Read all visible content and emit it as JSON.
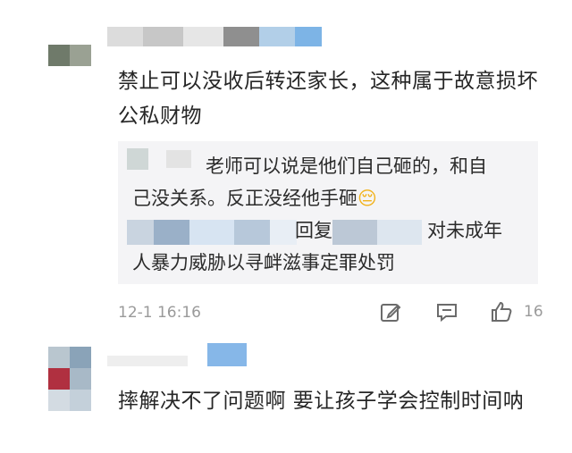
{
  "comment1": {
    "text": "禁止可以没收后转还家长，这种属于故意损坏公私财物",
    "reply": {
      "line1": "老师可以说是他们自己砸的，和自",
      "line2": "己没关系。反正没经他手砸",
      "line3_mid": "回复",
      "line3_end": "对未成年",
      "line4": "人暴力威胁以寻衅滋事定罪处罚"
    },
    "timestamp": "12-1 16:16",
    "like_count": "16"
  },
  "comment2": {
    "text": "摔解决不了问题啊 要让孩子学会控制时间呐"
  },
  "colors": {
    "reply_bg": "#f4f4f6",
    "meta_text": "#9a9a9a"
  }
}
